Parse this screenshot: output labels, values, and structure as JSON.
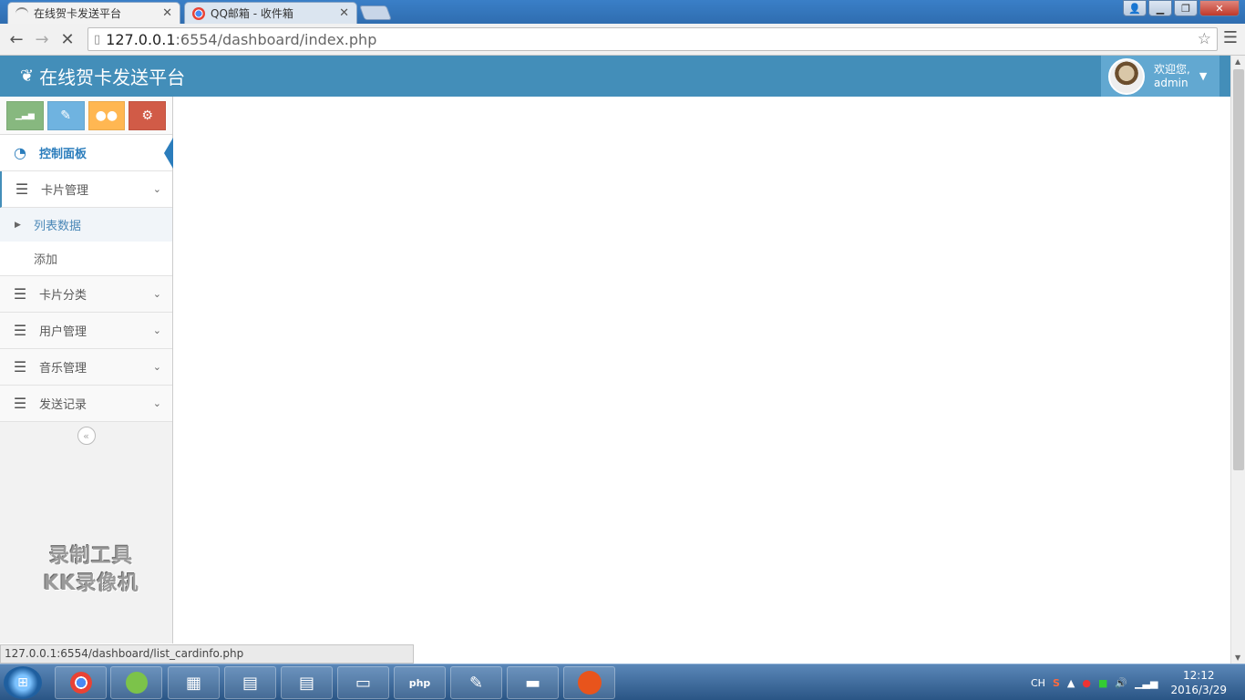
{
  "browser": {
    "tabs": [
      {
        "title": "在线贺卡发送平台",
        "active": true
      },
      {
        "title": "QQ邮箱 - 收件箱",
        "active": false
      }
    ],
    "url_host": "127.0.0.1",
    "url_rest": ":6554/dashboard/index.php",
    "status_url": "127.0.0.1:6554/dashboard/list_cardinfo.php"
  },
  "header": {
    "brand": "在线贺卡发送平台",
    "welcome": "欢迎您,",
    "username": "admin"
  },
  "shortcuts": [
    {
      "icon": "signal-icon",
      "glyph": "▁▃▅",
      "color": "#87b87f"
    },
    {
      "icon": "pencil-icon",
      "glyph": "✎",
      "color": "#6fb3e0"
    },
    {
      "icon": "group-icon",
      "glyph": "👥",
      "color": "#ffb752"
    },
    {
      "icon": "cogs-icon",
      "glyph": "⚙",
      "color": "#d15b47"
    }
  ],
  "sidebar": {
    "dashboard": "控制面板",
    "card_mgmt": "卡片管理",
    "card_sub": [
      "列表数据",
      "添加"
    ],
    "card_category": "卡片分类",
    "user_mgmt": "用户管理",
    "music_mgmt": "音乐管理",
    "send_log": "发送记录"
  },
  "watermark": {
    "line1": "录制工具",
    "line2": "KK录像机"
  },
  "taskbar": {
    "tray_lang": "CH",
    "time": "12:12",
    "date": "2016/3/29"
  }
}
